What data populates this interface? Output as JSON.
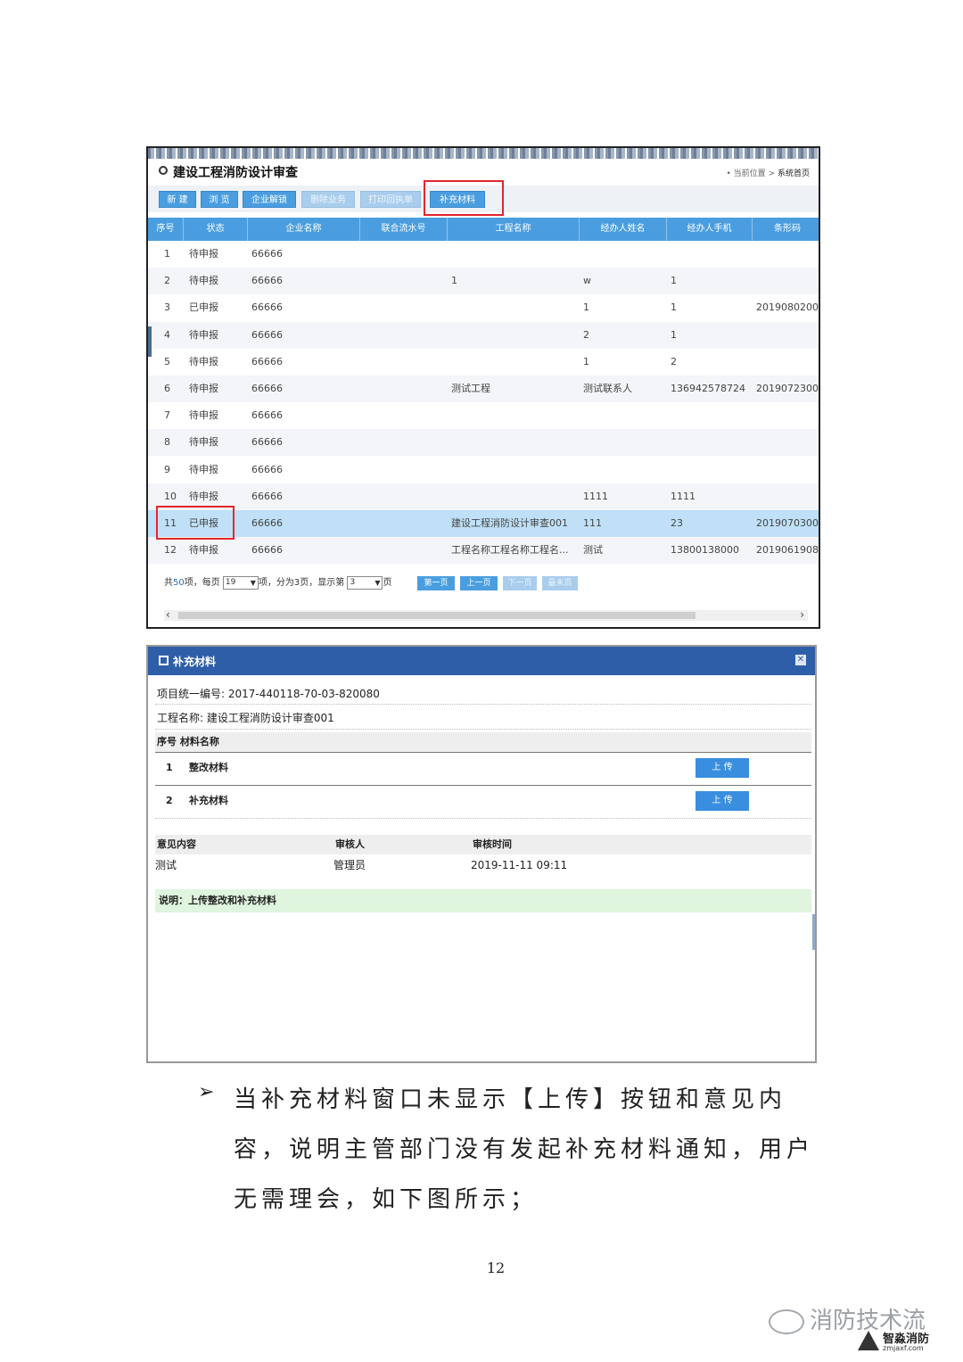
{
  "shot1": {
    "title": "建设工程消防设计审查",
    "breadcrumb": {
      "prefix": "当前位置",
      "sep": ">",
      "home": "系统首页"
    },
    "toolbar": [
      {
        "label": "新 建",
        "enabled": true
      },
      {
        "label": "浏 览",
        "enabled": true
      },
      {
        "label": "企业解锁",
        "enabled": true
      },
      {
        "label": "删除业务",
        "enabled": false
      },
      {
        "label": "打印回执单",
        "enabled": false
      },
      {
        "label": "补充材料",
        "enabled": true
      }
    ],
    "columns": [
      "序号",
      "状态",
      "企业名称",
      "联合流水号",
      "工程名称",
      "经办人姓名",
      "经办人手机",
      "条形码"
    ],
    "rows": [
      [
        "1",
        "待申报",
        "66666",
        "",
        "",
        "",
        "",
        ""
      ],
      [
        "2",
        "待申报",
        "66666",
        "",
        "1",
        "w",
        "1",
        ""
      ],
      [
        "3",
        "已申报",
        "66666",
        "",
        "",
        "1",
        "1",
        "2019080200"
      ],
      [
        "4",
        "待申报",
        "66666",
        "",
        "",
        "2",
        "1",
        ""
      ],
      [
        "5",
        "待申报",
        "66666",
        "",
        "",
        "1",
        "2",
        ""
      ],
      [
        "6",
        "待申报",
        "66666",
        "",
        "测试工程",
        "测试联系人",
        "136942578724",
        "2019072300"
      ],
      [
        "7",
        "待申报",
        "66666",
        "",
        "",
        "",
        "",
        ""
      ],
      [
        "8",
        "待申报",
        "66666",
        "",
        "",
        "",
        "",
        ""
      ],
      [
        "9",
        "待申报",
        "66666",
        "",
        "",
        "",
        "",
        ""
      ],
      [
        "10",
        "待申报",
        "66666",
        "",
        "",
        "1111",
        "1111",
        ""
      ],
      [
        "11",
        "已申报",
        "66666",
        "",
        "建设工程消防设计审查001",
        "111",
        "23",
        "2019070300"
      ],
      [
        "12",
        "待申报",
        "66666",
        "",
        "工程名称工程名称工程名...",
        "测试",
        "13800138000",
        "2019061908"
      ]
    ],
    "selected_row": 11,
    "pager": {
      "total_prefix": "共",
      "total": "50",
      "total_suffix": "项，每页",
      "per_page": "19",
      "mid": "项，分为3页，显示第",
      "current": "3",
      "page_suffix": "页",
      "buttons": [
        {
          "label": "第一页",
          "enabled": true
        },
        {
          "label": "上一页",
          "enabled": true
        },
        {
          "label": "下一页",
          "enabled": false
        },
        {
          "label": "最末页",
          "enabled": false
        }
      ]
    }
  },
  "dialog": {
    "title": "补充材料",
    "project_no_label": "项目统一编号:",
    "project_no": "2017-440118-70-03-820080",
    "project_name_label": "工程名称:",
    "project_name": "建设工程消防设计审查001",
    "mat_header": "序号  材料名称",
    "materials": [
      {
        "no": "1",
        "name": "整改材料",
        "button": "上 传"
      },
      {
        "no": "2",
        "name": "补充材料",
        "button": "上 传"
      }
    ],
    "opinion_headers": [
      "意见内容",
      "审核人",
      "审核时间"
    ],
    "opinion_row": [
      "测试",
      "管理员",
      "2019-11-11 09:11"
    ],
    "note": "说明：上传整改和补充材料"
  },
  "bullet": "➢",
  "paragraph": "当补充材料窗口未显示【上传】按钮和意见内容，说明主管部门没有发起补充材料通知，用户无需理会，如下图所示；",
  "page_number": "12",
  "watermark": {
    "channel": "消防技术流",
    "brand": "智淼消防",
    "site": "zmjaxf.com"
  }
}
